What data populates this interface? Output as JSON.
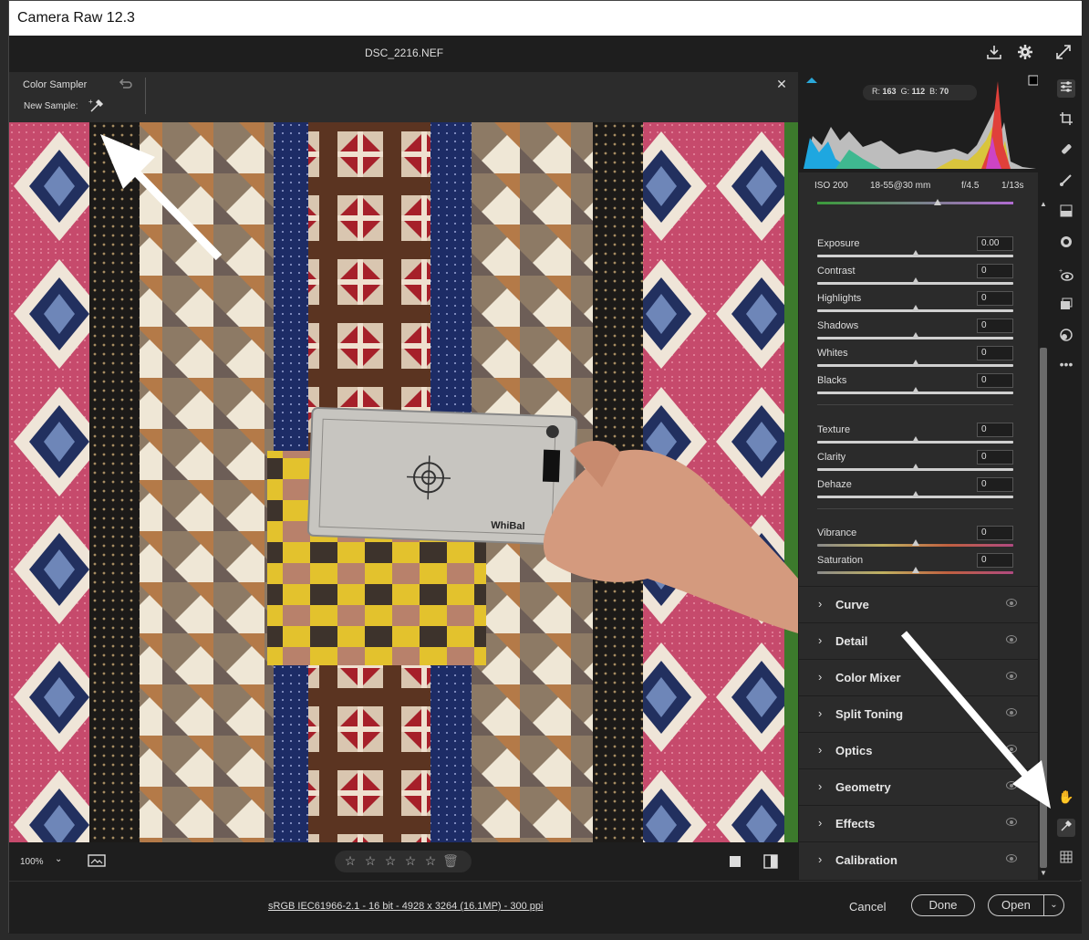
{
  "window": {
    "title": "Camera Raw 12.3"
  },
  "header": {
    "filename": "DSC_2216.NEF"
  },
  "tool_options": {
    "tool_name": "Color Sampler",
    "new_sample_label": "New Sample:"
  },
  "histogram": {
    "r_label": "R:",
    "r_value": "163",
    "g_label": "G:",
    "g_value": "112",
    "b_label": "B:",
    "b_value": "70"
  },
  "exif": {
    "iso": "ISO 200",
    "lens": "18-55@30 mm",
    "aperture": "f/4.5",
    "shutter": "1/13s"
  },
  "basic": {
    "sliders": [
      {
        "label": "Exposure",
        "value": "0.00",
        "level": 0.5
      },
      {
        "label": "Contrast",
        "value": "0",
        "level": 0.5
      },
      {
        "label": "Highlights",
        "value": "0",
        "level": 0.5
      },
      {
        "label": "Shadows",
        "value": "0",
        "level": 0.5
      },
      {
        "label": "Whites",
        "value": "0",
        "level": 0.5
      },
      {
        "label": "Blacks",
        "value": "0",
        "level": 0.5
      },
      {
        "label": "Texture",
        "value": "0",
        "level": 0.5
      },
      {
        "label": "Clarity",
        "value": "0",
        "level": 0.5
      },
      {
        "label": "Dehaze",
        "value": "0",
        "level": 0.5
      },
      {
        "label": "Vibrance",
        "value": "0",
        "level": 0.5
      },
      {
        "label": "Saturation",
        "value": "0",
        "level": 0.5
      }
    ]
  },
  "sections": [
    "Curve",
    "Detail",
    "Color Mixer",
    "Split Toning",
    "Optics",
    "Geometry",
    "Effects",
    "Calibration"
  ],
  "bottom": {
    "zoom": "100%"
  },
  "footer": {
    "info": "sRGB IEC61966-2.1 - 16 bit - 4928 x 3264 (16.1MP) - 300 ppi",
    "cancel": "Cancel",
    "done": "Done",
    "open": "Open"
  },
  "photo_card_text": "WhiBal",
  "colors": {
    "accent": "#1ea7e0",
    "panel": "#2b2b2b",
    "quilt_pink": "#c64a6c"
  }
}
